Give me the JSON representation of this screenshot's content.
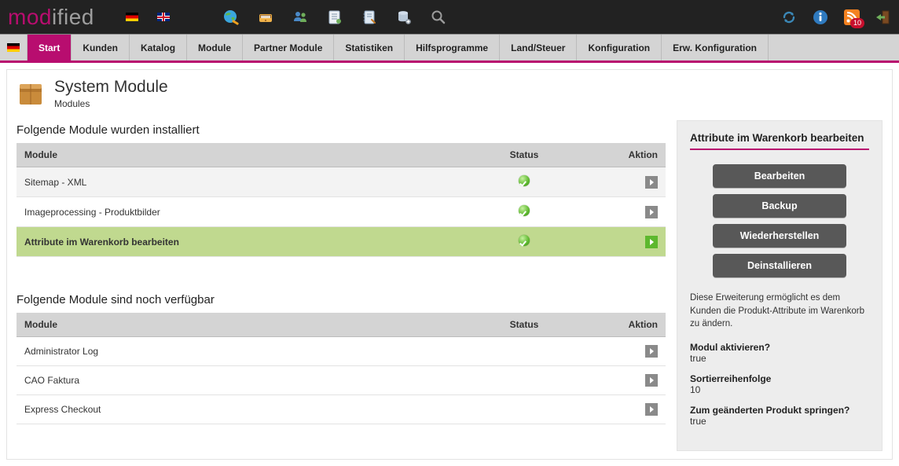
{
  "nav": {
    "items": [
      {
        "label": "Start",
        "active": true
      },
      {
        "label": "Kunden"
      },
      {
        "label": "Katalog"
      },
      {
        "label": "Module"
      },
      {
        "label": "Partner Module"
      },
      {
        "label": "Statistiken"
      },
      {
        "label": "Hilfsprogramme"
      },
      {
        "label": "Land/Steuer"
      },
      {
        "label": "Konfiguration"
      },
      {
        "label": "Erw. Konfiguration"
      }
    ]
  },
  "rss_badge": "10",
  "page": {
    "title": "System Module",
    "subtitle": "Modules"
  },
  "installed": {
    "heading": "Folgende Module wurden installiert",
    "cols": {
      "module": "Module",
      "status": "Status",
      "action": "Aktion"
    },
    "rows": [
      {
        "name": "Sitemap - XML",
        "status": true,
        "selected": false,
        "zebra": true
      },
      {
        "name": "Imageprocessing - Produktbilder",
        "status": true,
        "selected": false,
        "zebra": false
      },
      {
        "name": "Attribute im Warenkorb bearbeiten",
        "status": true,
        "selected": true,
        "zebra": false
      }
    ]
  },
  "available": {
    "heading": "Folgende Module sind noch verfügbar",
    "cols": {
      "module": "Module",
      "status": "Status",
      "action": "Aktion"
    },
    "rows": [
      {
        "name": "Administrator Log"
      },
      {
        "name": "CAO Faktura"
      },
      {
        "name": "Express Checkout"
      }
    ]
  },
  "panel": {
    "title": "Attribute im Warenkorb bearbeiten",
    "buttons": {
      "edit": "Bearbeiten",
      "backup": "Backup",
      "restore": "Wiederherstellen",
      "uninstall": "Deinstallieren"
    },
    "description": "Diese Erweiterung ermöglicht es dem Kunden die Produkt-Attribute im Warenkorb zu ändern.",
    "kv": [
      {
        "k": "Modul aktivieren?",
        "v": "true"
      },
      {
        "k": "Sortierreihenfolge",
        "v": "10"
      },
      {
        "k": "Zum geänderten Produkt springen?",
        "v": "true"
      }
    ]
  }
}
